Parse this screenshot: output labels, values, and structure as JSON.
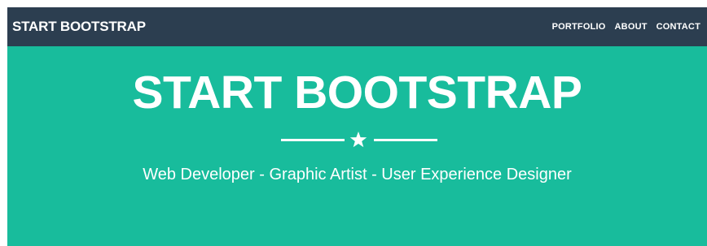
{
  "navbar": {
    "brand": "START BOOTSTRAP",
    "links": [
      "PORTFOLIO",
      "ABOUT",
      "CONTACT"
    ]
  },
  "hero": {
    "title": "START BOOTSTRAP",
    "divider_icon": "star-icon",
    "subtitle": "Web Developer - Graphic Artist - User Experience Designer"
  },
  "colors": {
    "navbar_bg": "#2c3e50",
    "hero_bg": "#18bc9c",
    "text": "#ffffff"
  }
}
